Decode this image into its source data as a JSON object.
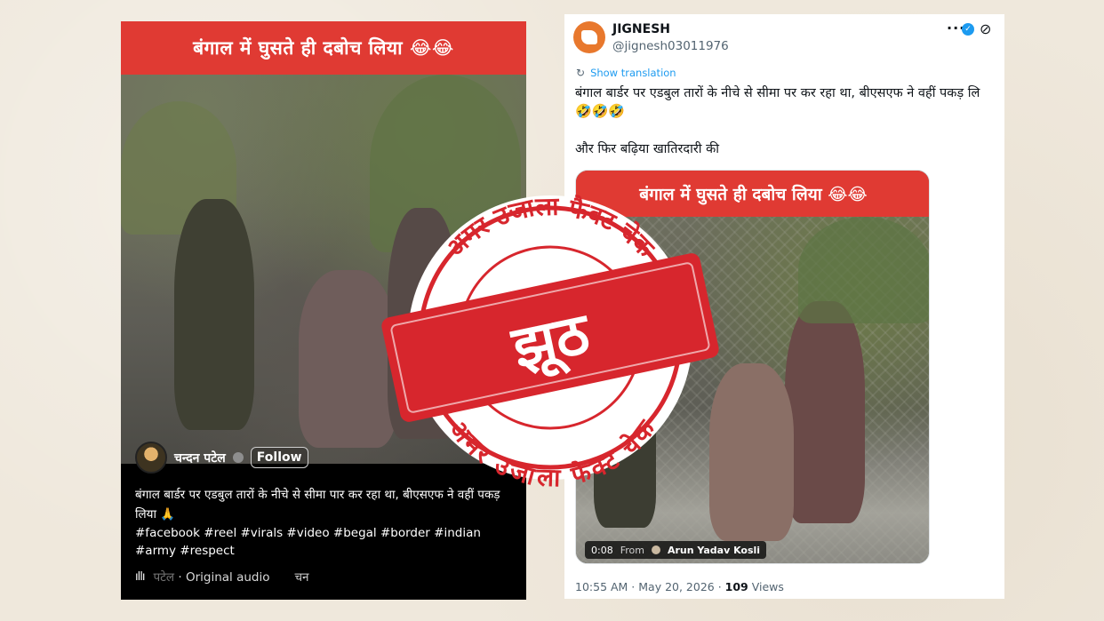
{
  "left": {
    "banner": "बंगाल में घुसते ही दबोच लिया 😂😂",
    "user_name": "चन्दन पटेल",
    "follow_label": "Follow",
    "description": "बंगाल बार्डर पर एडबुल तारों के नीचे से सीमा पार कर रहा था, बीएसएफ ने वहीं पकड़ लिया 🙏",
    "hashtags": "#facebook #reel #virals #video #begal #border #indian #army #respect",
    "audio_user": "पटेल",
    "audio_label": "· Original audio",
    "audio_trail": "चन"
  },
  "tweet": {
    "name": "JIGNESH",
    "handle": "@jignesh03011976",
    "more": "···",
    "translate_label": "Show translation",
    "text_line1": "बंगाल बार्डर पर एडबुल तारों के नीचे से सीमा पर कर रहा था, बीएसएफ ने वहीं पकड़ लि",
    "emojis": "🤣🤣🤣",
    "text_line2": "और फिर बढ़िया खातिरदारी की",
    "media_banner": "बंगाल में घुसते ही दबोच लिया 😂😂",
    "video_time": "0:08",
    "from_label": "From",
    "from_author": "Arun Yadav Kosli",
    "timestamp": "10:55 AM · May 20, 2026 · ",
    "views_count": "109",
    "views_label": " Views"
  },
  "stamp": {
    "brand_top": "अमर उजाला फैक्ट चेक",
    "brand_bottom": "अमर उजाला फैक्ट चेक",
    "verdict": "झूठ",
    "color": "#d7262d"
  }
}
